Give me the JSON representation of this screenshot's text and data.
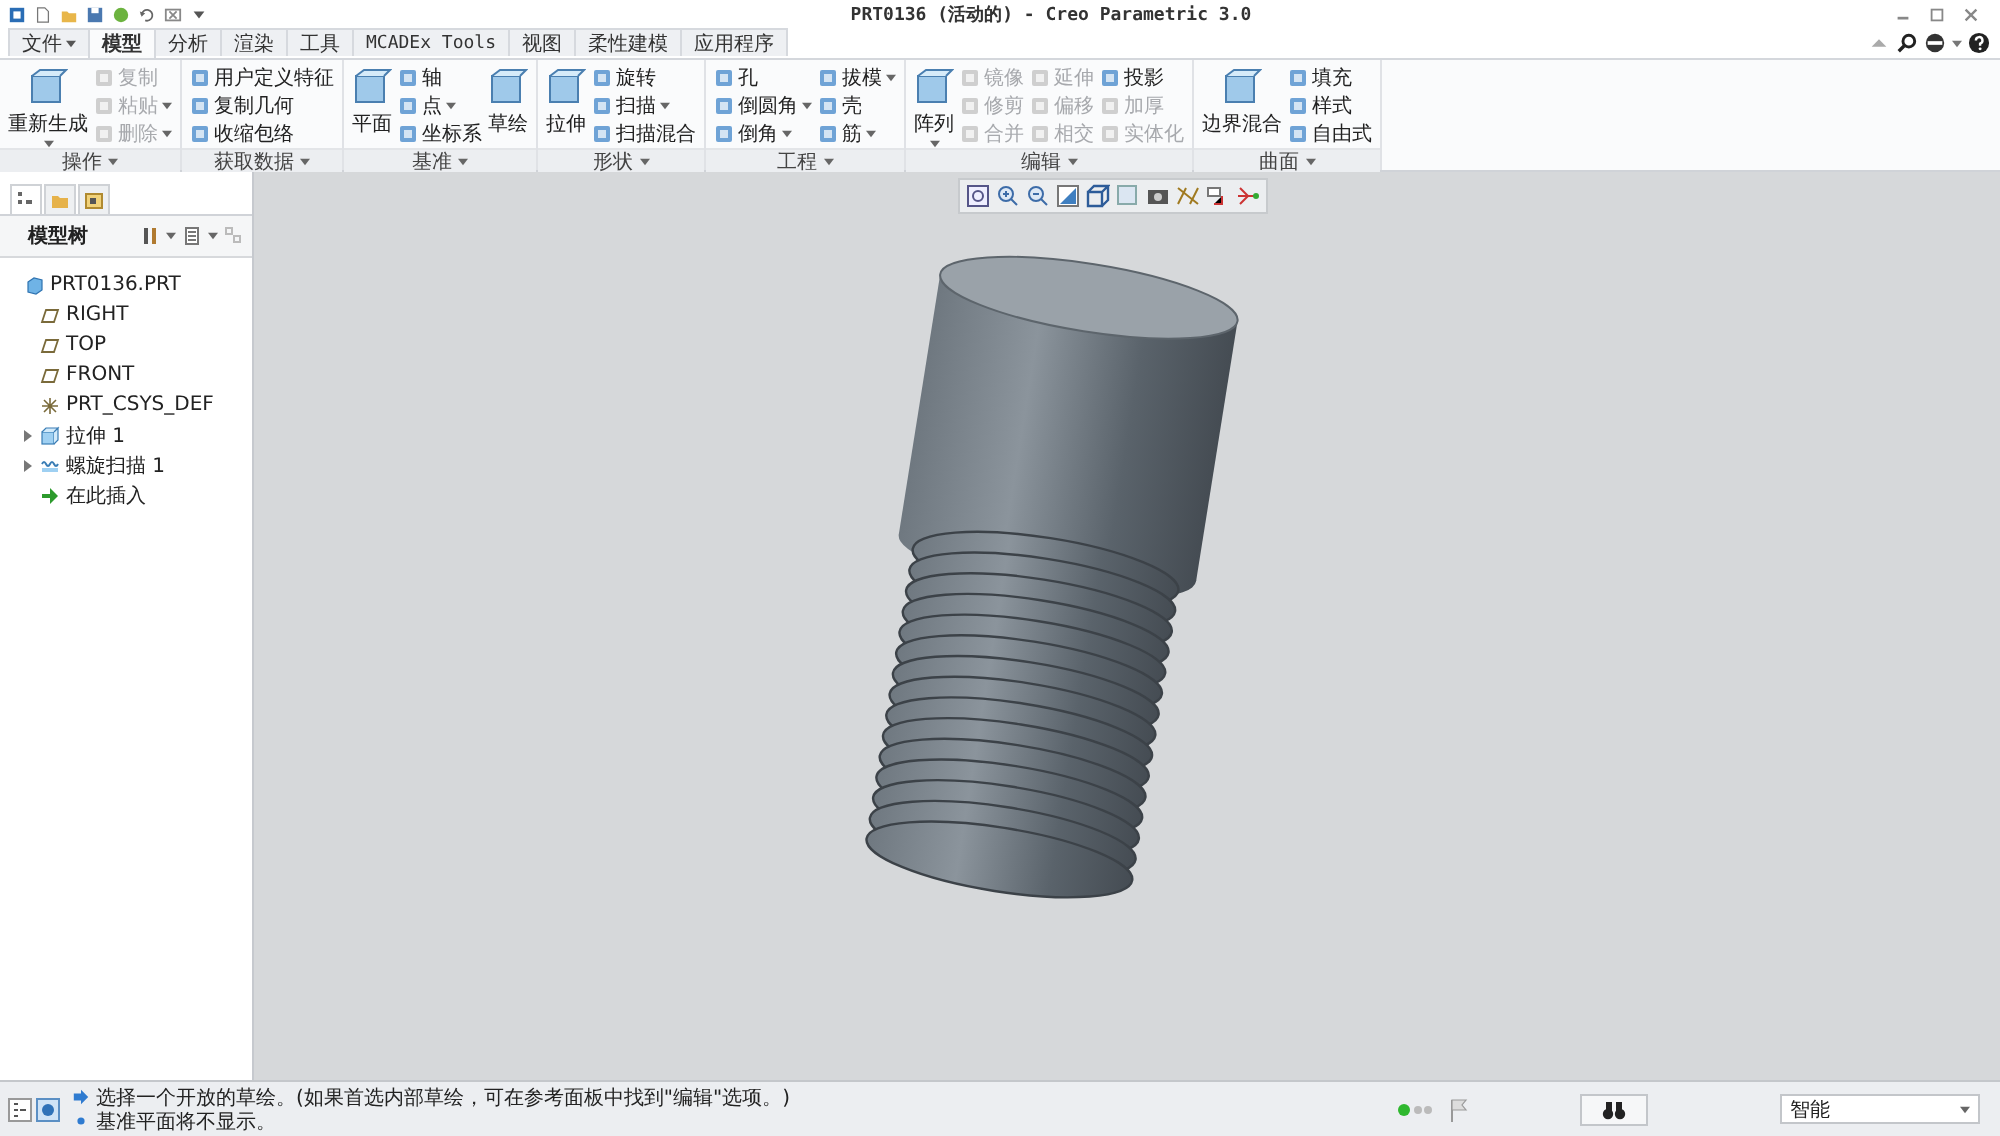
{
  "window": {
    "title": "PRT0136 (活动的) - Creo Parametric 3.0"
  },
  "tabs": [
    {
      "label": "文件",
      "selected": false,
      "dropdown": true
    },
    {
      "label": "模型",
      "selected": true,
      "dropdown": false
    },
    {
      "label": "分析",
      "selected": false,
      "dropdown": false
    },
    {
      "label": "渲染",
      "selected": false,
      "dropdown": false
    },
    {
      "label": "工具",
      "selected": false,
      "dropdown": false
    },
    {
      "label": "MCADEx Tools",
      "selected": false,
      "dropdown": false
    },
    {
      "label": "视图",
      "selected": false,
      "dropdown": false
    },
    {
      "label": "柔性建模",
      "selected": false,
      "dropdown": false
    },
    {
      "label": "应用程序",
      "selected": false,
      "dropdown": false
    }
  ],
  "ribbon_groups": [
    {
      "label": "操作",
      "items": [
        {
          "label": "重新生成",
          "kind": "large",
          "disabled": false,
          "dropdown": true
        },
        {
          "label": "复制",
          "kind": "small",
          "disabled": true,
          "dropdown": false
        },
        {
          "label": "粘贴",
          "kind": "small",
          "disabled": true,
          "dropdown": true
        },
        {
          "label": "删除",
          "kind": "small",
          "disabled": true,
          "dropdown": true
        }
      ]
    },
    {
      "label": "获取数据",
      "items": [
        {
          "label": "用户定义特征",
          "kind": "small",
          "disabled": false,
          "dropdown": false
        },
        {
          "label": "复制几何",
          "kind": "small",
          "disabled": false,
          "dropdown": false
        },
        {
          "label": "收缩包络",
          "kind": "small",
          "disabled": false,
          "dropdown": false
        }
      ]
    },
    {
      "label": "基准",
      "items": [
        {
          "label": "平面",
          "kind": "large",
          "disabled": false,
          "dropdown": false
        },
        {
          "label": "轴",
          "kind": "small",
          "disabled": false,
          "dropdown": false
        },
        {
          "label": "点",
          "kind": "small",
          "disabled": false,
          "dropdown": true
        },
        {
          "label": "坐标系",
          "kind": "small",
          "disabled": false,
          "dropdown": false
        },
        {
          "label": "草绘",
          "kind": "large",
          "disabled": false,
          "dropdown": false
        }
      ]
    },
    {
      "label": "形状",
      "items": [
        {
          "label": "拉伸",
          "kind": "large",
          "disabled": false,
          "dropdown": false
        },
        {
          "label": "旋转",
          "kind": "small",
          "disabled": false,
          "dropdown": false
        },
        {
          "label": "扫描",
          "kind": "small",
          "disabled": false,
          "dropdown": true
        },
        {
          "label": "扫描混合",
          "kind": "small",
          "disabled": false,
          "dropdown": false
        }
      ]
    },
    {
      "label": "工程",
      "items": [
        {
          "label": "孔",
          "kind": "small",
          "disabled": false,
          "dropdown": false
        },
        {
          "label": "倒圆角",
          "kind": "small",
          "disabled": false,
          "dropdown": true
        },
        {
          "label": "倒角",
          "kind": "small",
          "disabled": false,
          "dropdown": true
        },
        {
          "label": "拔模",
          "kind": "small",
          "disabled": false,
          "dropdown": true
        },
        {
          "label": "壳",
          "kind": "small",
          "disabled": false,
          "dropdown": false
        },
        {
          "label": "筋",
          "kind": "small",
          "disabled": false,
          "dropdown": true
        }
      ]
    },
    {
      "label": "编辑",
      "items": [
        {
          "label": "阵列",
          "kind": "large",
          "disabled": false,
          "dropdown": true
        },
        {
          "label": "镜像",
          "kind": "small",
          "disabled": true,
          "dropdown": false
        },
        {
          "label": "修剪",
          "kind": "small",
          "disabled": true,
          "dropdown": false
        },
        {
          "label": "合并",
          "kind": "small",
          "disabled": true,
          "dropdown": false
        },
        {
          "label": "延伸",
          "kind": "small",
          "disabled": true,
          "dropdown": false
        },
        {
          "label": "偏移",
          "kind": "small",
          "disabled": true,
          "dropdown": false
        },
        {
          "label": "相交",
          "kind": "small",
          "disabled": true,
          "dropdown": false
        },
        {
          "label": "投影",
          "kind": "small",
          "disabled": false,
          "dropdown": false
        },
        {
          "label": "加厚",
          "kind": "small",
          "disabled": true,
          "dropdown": false
        },
        {
          "label": "实体化",
          "kind": "small",
          "disabled": true,
          "dropdown": false
        }
      ]
    },
    {
      "label": "曲面",
      "items": [
        {
          "label": "边界混合",
          "kind": "large",
          "disabled": false,
          "dropdown": false
        },
        {
          "label": "填充",
          "kind": "small",
          "disabled": false,
          "dropdown": false
        },
        {
          "label": "样式",
          "kind": "small",
          "disabled": false,
          "dropdown": false
        },
        {
          "label": "自由式",
          "kind": "small",
          "disabled": false,
          "dropdown": false
        }
      ]
    }
  ],
  "model_tree": {
    "title": "模型树",
    "items": [
      {
        "label": "PRT0136.PRT",
        "kind": "part",
        "expandable": false,
        "children": [
          {
            "label": "RIGHT",
            "kind": "plane",
            "expandable": false
          },
          {
            "label": "TOP",
            "kind": "plane",
            "expandable": false
          },
          {
            "label": "FRONT",
            "kind": "plane",
            "expandable": false
          },
          {
            "label": "PRT_CSYS_DEF",
            "kind": "csys",
            "expandable": false
          },
          {
            "label": "拉伸 1",
            "kind": "extrude",
            "expandable": true
          },
          {
            "label": "螺旋扫描 1",
            "kind": "helix",
            "expandable": true
          },
          {
            "label": "在此插入",
            "kind": "insert",
            "expandable": false
          }
        ]
      }
    ]
  },
  "status_bar": {
    "messages": [
      {
        "kind": "prompt",
        "text": "选择一个开放的草绘。(如果首选内部草绘，可在参考面板中找到\"编辑\"选项。)"
      },
      {
        "kind": "note",
        "text": "基准平面将不显示。"
      }
    ],
    "filter": {
      "value": "智能"
    }
  }
}
